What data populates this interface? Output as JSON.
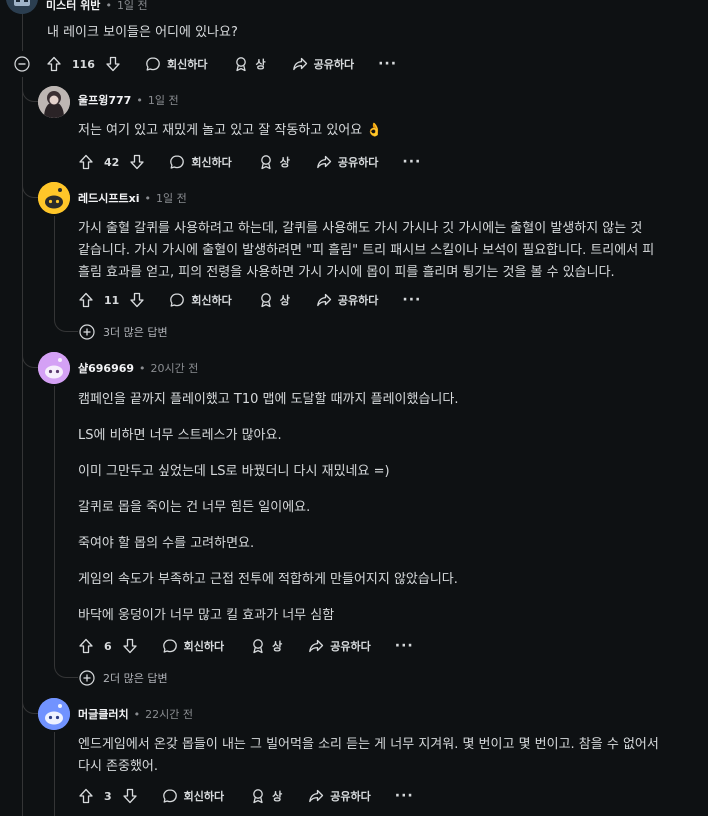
{
  "comments": [
    {
      "author": "미스터 위반",
      "time": "1일 전",
      "body": [
        "내 레이크 보이들은 어디에 있나요?"
      ],
      "votes": "116",
      "reply_label": "회신하다",
      "award_label": "상",
      "share_label": "공유하다",
      "more_label": "···"
    },
    {
      "author": "울프윙777",
      "time": "1일 전",
      "body": [
        "저는 여기 있고 재밌게 놀고 있고 잘 작동하고 있어요 👌"
      ],
      "votes": "42",
      "reply_label": "회신하다",
      "award_label": "상",
      "share_label": "공유하다",
      "more_label": "···"
    },
    {
      "author": "레드시프트xi",
      "time": "1일 전",
      "body": [
        "가시 출혈 갈퀴를 사용하려고 하는데, 갈퀴를 사용해도 가시 가시나 깃 가시에는 출혈이 발생하지 않는 것",
        "같습니다. 가시 가시에 출혈이 발생하려면 \"피 흘림\" 트리 패시브 스킬이나 보석이 필요합니다. 트리에서 피",
        "흘림 효과를 얻고, 피의 전령을 사용하면 가시 가시에 몹이 피를 흘리며 튕기는 것을 볼 수 있습니다."
      ],
      "votes": "11",
      "reply_label": "회신하다",
      "award_label": "상",
      "share_label": "공유하다",
      "more_label": "···",
      "more_replies": "3더 많은 답변"
    },
    {
      "author": "샬696969",
      "time": "20시간 전",
      "body": [
        "캠페인을 끝까지 플레이했고 T10 맵에 도달할 때까지 플레이했습니다.",
        "LS에 비하면 너무 스트레스가 많아요.",
        "이미 그만두고 싶었는데 LS로 바꿨더니 다시 재밌네요 =)",
        "갈퀴로 몹을 죽이는 건 너무 힘든 일이에요.",
        "죽여야 할 몹의 수를 고려하면요.",
        "게임의 속도가 부족하고 근접 전투에 적합하게 만들어지지 않았습니다.",
        "바닥에 웅덩이가 너무 많고 킬 효과가 너무 심함"
      ],
      "votes": "6",
      "reply_label": "회신하다",
      "award_label": "상",
      "share_label": "공유하다",
      "more_label": "···",
      "more_replies": "2더 많은 답변"
    },
    {
      "author": "머글클러치",
      "time": "22시간 전",
      "body": [
        "엔드게임에서 온갖 몹들이 내는 그 빌어먹을 소리 듣는 게 너무 지겨워. 몇 번이고 몇 번이고. 참을 수 없어서",
        "다시 존중했어."
      ],
      "votes": "3",
      "reply_label": "회신하다",
      "award_label": "상",
      "share_label": "공유하다",
      "more_label": "···"
    }
  ],
  "colors": {
    "background": "#0e1113",
    "text": "#d7dadc",
    "muted": "#8a8d91",
    "thread_line": "#343536",
    "avatar_yellow": "#ffc629",
    "avatar_pink": "#d4a1f5",
    "avatar_blue": "#7193ff"
  },
  "icons": [
    "collapse-icon",
    "upvote-icon",
    "downvote-icon",
    "comment-icon",
    "award-icon",
    "share-icon",
    "plus-circle-icon"
  ]
}
